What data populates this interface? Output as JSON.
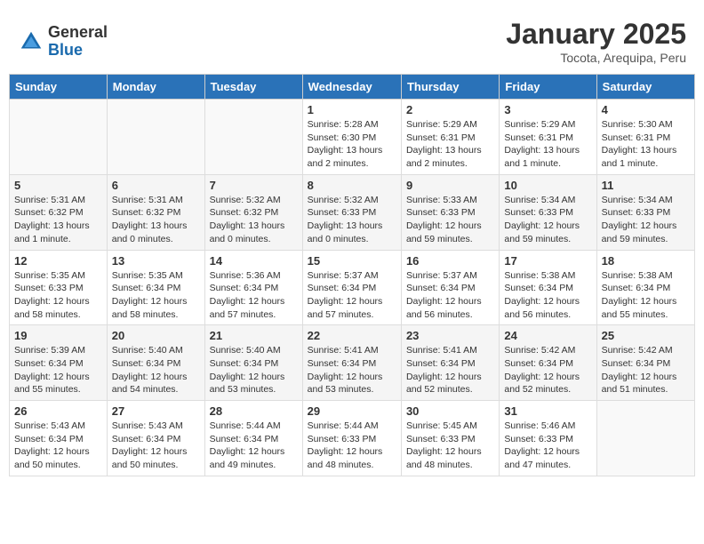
{
  "header": {
    "logo_general": "General",
    "logo_blue": "Blue",
    "month_title": "January 2025",
    "location": "Tocota, Arequipa, Peru"
  },
  "weekdays": [
    "Sunday",
    "Monday",
    "Tuesday",
    "Wednesday",
    "Thursday",
    "Friday",
    "Saturday"
  ],
  "weeks": [
    [
      {
        "day": "",
        "info": ""
      },
      {
        "day": "",
        "info": ""
      },
      {
        "day": "",
        "info": ""
      },
      {
        "day": "1",
        "info": "Sunrise: 5:28 AM\nSunset: 6:30 PM\nDaylight: 13 hours\nand 2 minutes."
      },
      {
        "day": "2",
        "info": "Sunrise: 5:29 AM\nSunset: 6:31 PM\nDaylight: 13 hours\nand 2 minutes."
      },
      {
        "day": "3",
        "info": "Sunrise: 5:29 AM\nSunset: 6:31 PM\nDaylight: 13 hours\nand 1 minute."
      },
      {
        "day": "4",
        "info": "Sunrise: 5:30 AM\nSunset: 6:31 PM\nDaylight: 13 hours\nand 1 minute."
      }
    ],
    [
      {
        "day": "5",
        "info": "Sunrise: 5:31 AM\nSunset: 6:32 PM\nDaylight: 13 hours\nand 1 minute."
      },
      {
        "day": "6",
        "info": "Sunrise: 5:31 AM\nSunset: 6:32 PM\nDaylight: 13 hours\nand 0 minutes."
      },
      {
        "day": "7",
        "info": "Sunrise: 5:32 AM\nSunset: 6:32 PM\nDaylight: 13 hours\nand 0 minutes."
      },
      {
        "day": "8",
        "info": "Sunrise: 5:32 AM\nSunset: 6:33 PM\nDaylight: 13 hours\nand 0 minutes."
      },
      {
        "day": "9",
        "info": "Sunrise: 5:33 AM\nSunset: 6:33 PM\nDaylight: 12 hours\nand 59 minutes."
      },
      {
        "day": "10",
        "info": "Sunrise: 5:34 AM\nSunset: 6:33 PM\nDaylight: 12 hours\nand 59 minutes."
      },
      {
        "day": "11",
        "info": "Sunrise: 5:34 AM\nSunset: 6:33 PM\nDaylight: 12 hours\nand 59 minutes."
      }
    ],
    [
      {
        "day": "12",
        "info": "Sunrise: 5:35 AM\nSunset: 6:33 PM\nDaylight: 12 hours\nand 58 minutes."
      },
      {
        "day": "13",
        "info": "Sunrise: 5:35 AM\nSunset: 6:34 PM\nDaylight: 12 hours\nand 58 minutes."
      },
      {
        "day": "14",
        "info": "Sunrise: 5:36 AM\nSunset: 6:34 PM\nDaylight: 12 hours\nand 57 minutes."
      },
      {
        "day": "15",
        "info": "Sunrise: 5:37 AM\nSunset: 6:34 PM\nDaylight: 12 hours\nand 57 minutes."
      },
      {
        "day": "16",
        "info": "Sunrise: 5:37 AM\nSunset: 6:34 PM\nDaylight: 12 hours\nand 56 minutes."
      },
      {
        "day": "17",
        "info": "Sunrise: 5:38 AM\nSunset: 6:34 PM\nDaylight: 12 hours\nand 56 minutes."
      },
      {
        "day": "18",
        "info": "Sunrise: 5:38 AM\nSunset: 6:34 PM\nDaylight: 12 hours\nand 55 minutes."
      }
    ],
    [
      {
        "day": "19",
        "info": "Sunrise: 5:39 AM\nSunset: 6:34 PM\nDaylight: 12 hours\nand 55 minutes."
      },
      {
        "day": "20",
        "info": "Sunrise: 5:40 AM\nSunset: 6:34 PM\nDaylight: 12 hours\nand 54 minutes."
      },
      {
        "day": "21",
        "info": "Sunrise: 5:40 AM\nSunset: 6:34 PM\nDaylight: 12 hours\nand 53 minutes."
      },
      {
        "day": "22",
        "info": "Sunrise: 5:41 AM\nSunset: 6:34 PM\nDaylight: 12 hours\nand 53 minutes."
      },
      {
        "day": "23",
        "info": "Sunrise: 5:41 AM\nSunset: 6:34 PM\nDaylight: 12 hours\nand 52 minutes."
      },
      {
        "day": "24",
        "info": "Sunrise: 5:42 AM\nSunset: 6:34 PM\nDaylight: 12 hours\nand 52 minutes."
      },
      {
        "day": "25",
        "info": "Sunrise: 5:42 AM\nSunset: 6:34 PM\nDaylight: 12 hours\nand 51 minutes."
      }
    ],
    [
      {
        "day": "26",
        "info": "Sunrise: 5:43 AM\nSunset: 6:34 PM\nDaylight: 12 hours\nand 50 minutes."
      },
      {
        "day": "27",
        "info": "Sunrise: 5:43 AM\nSunset: 6:34 PM\nDaylight: 12 hours\nand 50 minutes."
      },
      {
        "day": "28",
        "info": "Sunrise: 5:44 AM\nSunset: 6:34 PM\nDaylight: 12 hours\nand 49 minutes."
      },
      {
        "day": "29",
        "info": "Sunrise: 5:44 AM\nSunset: 6:33 PM\nDaylight: 12 hours\nand 48 minutes."
      },
      {
        "day": "30",
        "info": "Sunrise: 5:45 AM\nSunset: 6:33 PM\nDaylight: 12 hours\nand 48 minutes."
      },
      {
        "day": "31",
        "info": "Sunrise: 5:46 AM\nSunset: 6:33 PM\nDaylight: 12 hours\nand 47 minutes."
      },
      {
        "day": "",
        "info": ""
      }
    ]
  ]
}
